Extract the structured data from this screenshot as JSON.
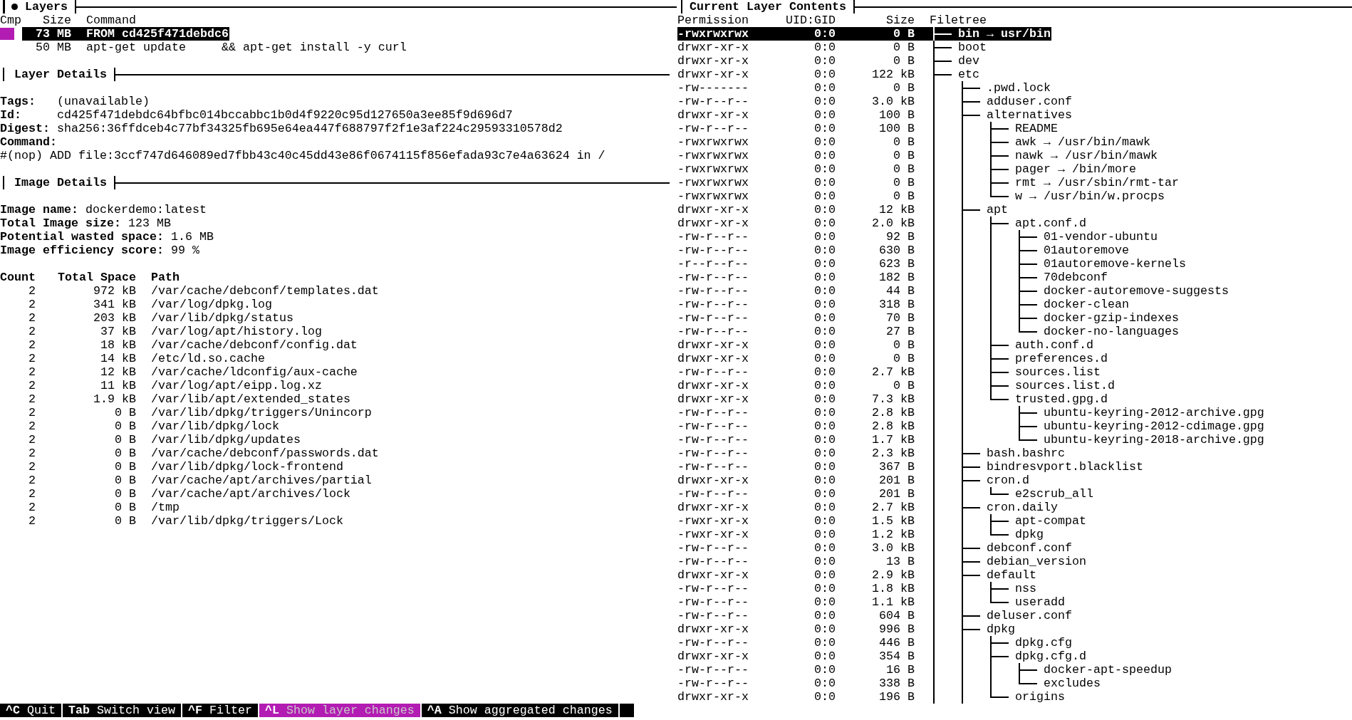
{
  "layers": {
    "title": "Layers",
    "focused": true,
    "columns": [
      "Cmp",
      "Size",
      "Command"
    ],
    "rows": [
      {
        "cmp": true,
        "size": "73 MB",
        "command": "FROM cd425f471debdc6",
        "selected": true
      },
      {
        "cmp": false,
        "size": "50 MB",
        "command": "apt-get update     && apt-get install -y curl",
        "selected": false
      }
    ]
  },
  "layer_details": {
    "title": "Layer Details",
    "fields": [
      {
        "kind": "inline",
        "label": "Tags:",
        "value": "(unavailable)"
      },
      {
        "kind": "inline",
        "label": "Id:",
        "value": "cd425f471debdc64bfbc014bccabbc1b0d4f9220c95d127650a3ee85f9d696d7"
      },
      {
        "kind": "inline",
        "label": "Digest:",
        "value": "sha256:36ffdceb4c77bf34325fb695e64ea447f688797f2f1e3af224c29593310578d2"
      },
      {
        "kind": "block",
        "label": "Command:",
        "value": "#(nop) ADD file:3ccf747d646089ed7fbb43c40c45dd43e86f0674115f856efada93c7e4a63624 in /"
      }
    ]
  },
  "image_details": {
    "title": "Image Details",
    "fields": [
      {
        "label": "Image name:",
        "value": "dockerdemo:latest"
      },
      {
        "label": "Total Image size:",
        "value": "123 MB"
      },
      {
        "label": "Potential wasted space:",
        "value": "1.6 MB"
      },
      {
        "label": "Image efficiency score:",
        "value": "99 %"
      }
    ],
    "columns": [
      "Count",
      "Total Space",
      "Path"
    ],
    "rows": [
      {
        "count": "2",
        "total_space": "972 kB",
        "path": "/var/cache/debconf/templates.dat"
      },
      {
        "count": "2",
        "total_space": "341 kB",
        "path": "/var/log/dpkg.log"
      },
      {
        "count": "2",
        "total_space": "203 kB",
        "path": "/var/lib/dpkg/status"
      },
      {
        "count": "2",
        "total_space": "37 kB",
        "path": "/var/log/apt/history.log"
      },
      {
        "count": "2",
        "total_space": "18 kB",
        "path": "/var/cache/debconf/config.dat"
      },
      {
        "count": "2",
        "total_space": "14 kB",
        "path": "/etc/ld.so.cache"
      },
      {
        "count": "2",
        "total_space": "12 kB",
        "path": "/var/cache/ldconfig/aux-cache"
      },
      {
        "count": "2",
        "total_space": "11 kB",
        "path": "/var/log/apt/eipp.log.xz"
      },
      {
        "count": "2",
        "total_space": "1.9 kB",
        "path": "/var/lib/apt/extended_states"
      },
      {
        "count": "2",
        "total_space": "0 B",
        "path": "/var/lib/dpkg/triggers/Unincorp"
      },
      {
        "count": "2",
        "total_space": "0 B",
        "path": "/var/lib/dpkg/lock"
      },
      {
        "count": "2",
        "total_space": "0 B",
        "path": "/var/lib/dpkg/updates"
      },
      {
        "count": "2",
        "total_space": "0 B",
        "path": "/var/cache/debconf/passwords.dat"
      },
      {
        "count": "2",
        "total_space": "0 B",
        "path": "/var/lib/dpkg/lock-frontend"
      },
      {
        "count": "2",
        "total_space": "0 B",
        "path": "/var/cache/apt/archives/partial"
      },
      {
        "count": "2",
        "total_space": "0 B",
        "path": "/var/cache/apt/archives/lock"
      },
      {
        "count": "2",
        "total_space": "0 B",
        "path": "/tmp"
      },
      {
        "count": "2",
        "total_space": "0 B",
        "path": "/var/lib/dpkg/triggers/Lock"
      }
    ]
  },
  "filetree": {
    "title": "Current Layer Contents",
    "columns": [
      "Permission",
      "UID:GID",
      "Size",
      "Filetree"
    ],
    "cut": true,
    "entries": [
      {
        "permission": "-rwxrwxrwx",
        "uid_gid": "0:0",
        "size": "0 B",
        "name": "bin → usr/bin",
        "selected": true
      },
      {
        "permission": "drwxr-xr-x",
        "uid_gid": "0:0",
        "size": "0 B",
        "name": "boot",
        "selected": false
      },
      {
        "permission": "drwxr-xr-x",
        "uid_gid": "0:0",
        "size": "0 B",
        "name": "dev",
        "selected": false
      },
      {
        "permission": "drwxr-xr-x",
        "uid_gid": "0:0",
        "size": "122 kB",
        "name": "etc",
        "selected": false,
        "cut": true,
        "children": [
          {
            "permission": "-rw-------",
            "uid_gid": "0:0",
            "size": "0 B",
            "name": ".pwd.lock",
            "selected": false
          },
          {
            "permission": "-rw-r--r--",
            "uid_gid": "0:0",
            "size": "3.0 kB",
            "name": "adduser.conf",
            "selected": false
          },
          {
            "permission": "drwxr-xr-x",
            "uid_gid": "0:0",
            "size": "100 B",
            "name": "alternatives",
            "selected": false,
            "children": [
              {
                "permission": "-rw-r--r--",
                "uid_gid": "0:0",
                "size": "100 B",
                "name": "README",
                "selected": false
              },
              {
                "permission": "-rwxrwxrwx",
                "uid_gid": "0:0",
                "size": "0 B",
                "name": "awk → /usr/bin/mawk",
                "selected": false
              },
              {
                "permission": "-rwxrwxrwx",
                "uid_gid": "0:0",
                "size": "0 B",
                "name": "nawk → /usr/bin/mawk",
                "selected": false
              },
              {
                "permission": "-rwxrwxrwx",
                "uid_gid": "0:0",
                "size": "0 B",
                "name": "pager → /bin/more",
                "selected": false
              },
              {
                "permission": "-rwxrwxrwx",
                "uid_gid": "0:0",
                "size": "0 B",
                "name": "rmt → /usr/sbin/rmt-tar",
                "selected": false
              },
              {
                "permission": "-rwxrwxrwx",
                "uid_gid": "0:0",
                "size": "0 B",
                "name": "w → /usr/bin/w.procps",
                "selected": false
              }
            ]
          },
          {
            "permission": "drwxr-xr-x",
            "uid_gid": "0:0",
            "size": "12 kB",
            "name": "apt",
            "selected": false,
            "children": [
              {
                "permission": "drwxr-xr-x",
                "uid_gid": "0:0",
                "size": "2.0 kB",
                "name": "apt.conf.d",
                "selected": false,
                "children": [
                  {
                    "permission": "-rw-r--r--",
                    "uid_gid": "0:0",
                    "size": "92 B",
                    "name": "01-vendor-ubuntu",
                    "selected": false
                  },
                  {
                    "permission": "-rw-r--r--",
                    "uid_gid": "0:0",
                    "size": "630 B",
                    "name": "01autoremove",
                    "selected": false
                  },
                  {
                    "permission": "-r--r--r--",
                    "uid_gid": "0:0",
                    "size": "623 B",
                    "name": "01autoremove-kernels",
                    "selected": false
                  },
                  {
                    "permission": "-rw-r--r--",
                    "uid_gid": "0:0",
                    "size": "182 B",
                    "name": "70debconf",
                    "selected": false
                  },
                  {
                    "permission": "-rw-r--r--",
                    "uid_gid": "0:0",
                    "size": "44 B",
                    "name": "docker-autoremove-suggests",
                    "selected": false
                  },
                  {
                    "permission": "-rw-r--r--",
                    "uid_gid": "0:0",
                    "size": "318 B",
                    "name": "docker-clean",
                    "selected": false
                  },
                  {
                    "permission": "-rw-r--r--",
                    "uid_gid": "0:0",
                    "size": "70 B",
                    "name": "docker-gzip-indexes",
                    "selected": false
                  },
                  {
                    "permission": "-rw-r--r--",
                    "uid_gid": "0:0",
                    "size": "27 B",
                    "name": "docker-no-languages",
                    "selected": false
                  }
                ]
              },
              {
                "permission": "drwxr-xr-x",
                "uid_gid": "0:0",
                "size": "0 B",
                "name": "auth.conf.d",
                "selected": false
              },
              {
                "permission": "drwxr-xr-x",
                "uid_gid": "0:0",
                "size": "0 B",
                "name": "preferences.d",
                "selected": false
              },
              {
                "permission": "-rw-r--r--",
                "uid_gid": "0:0",
                "size": "2.7 kB",
                "name": "sources.list",
                "selected": false
              },
              {
                "permission": "drwxr-xr-x",
                "uid_gid": "0:0",
                "size": "0 B",
                "name": "sources.list.d",
                "selected": false
              },
              {
                "permission": "drwxr-xr-x",
                "uid_gid": "0:0",
                "size": "7.3 kB",
                "name": "trusted.gpg.d",
                "selected": false,
                "children": [
                  {
                    "permission": "-rw-r--r--",
                    "uid_gid": "0:0",
                    "size": "2.8 kB",
                    "name": "ubuntu-keyring-2012-archive.gpg",
                    "selected": false
                  },
                  {
                    "permission": "-rw-r--r--",
                    "uid_gid": "0:0",
                    "size": "2.8 kB",
                    "name": "ubuntu-keyring-2012-cdimage.gpg",
                    "selected": false
                  },
                  {
                    "permission": "-rw-r--r--",
                    "uid_gid": "0:0",
                    "size": "1.7 kB",
                    "name": "ubuntu-keyring-2018-archive.gpg",
                    "selected": false
                  }
                ]
              }
            ]
          },
          {
            "permission": "-rw-r--r--",
            "uid_gid": "0:0",
            "size": "2.3 kB",
            "name": "bash.bashrc",
            "selected": false
          },
          {
            "permission": "-rw-r--r--",
            "uid_gid": "0:0",
            "size": "367 B",
            "name": "bindresvport.blacklist",
            "selected": false
          },
          {
            "permission": "drwxr-xr-x",
            "uid_gid": "0:0",
            "size": "201 B",
            "name": "cron.d",
            "selected": false,
            "children": [
              {
                "permission": "-rw-r--r--",
                "uid_gid": "0:0",
                "size": "201 B",
                "name": "e2scrub_all",
                "selected": false
              }
            ]
          },
          {
            "permission": "drwxr-xr-x",
            "uid_gid": "0:0",
            "size": "2.7 kB",
            "name": "cron.daily",
            "selected": false,
            "children": [
              {
                "permission": "-rwxr-xr-x",
                "uid_gid": "0:0",
                "size": "1.5 kB",
                "name": "apt-compat",
                "selected": false
              },
              {
                "permission": "-rwxr-xr-x",
                "uid_gid": "0:0",
                "size": "1.2 kB",
                "name": "dpkg",
                "selected": false
              }
            ]
          },
          {
            "permission": "-rw-r--r--",
            "uid_gid": "0:0",
            "size": "3.0 kB",
            "name": "debconf.conf",
            "selected": false
          },
          {
            "permission": "-rw-r--r--",
            "uid_gid": "0:0",
            "size": "13 B",
            "name": "debian_version",
            "selected": false
          },
          {
            "permission": "drwxr-xr-x",
            "uid_gid": "0:0",
            "size": "2.9 kB",
            "name": "default",
            "selected": false,
            "children": [
              {
                "permission": "-rw-r--r--",
                "uid_gid": "0:0",
                "size": "1.8 kB",
                "name": "nss",
                "selected": false
              },
              {
                "permission": "-rw-r--r--",
                "uid_gid": "0:0",
                "size": "1.1 kB",
                "name": "useradd",
                "selected": false
              }
            ]
          },
          {
            "permission": "-rw-r--r--",
            "uid_gid": "0:0",
            "size": "604 B",
            "name": "deluser.conf",
            "selected": false
          },
          {
            "permission": "drwxr-xr-x",
            "uid_gid": "0:0",
            "size": "996 B",
            "name": "dpkg",
            "selected": false,
            "children": [
              {
                "permission": "-rw-r--r--",
                "uid_gid": "0:0",
                "size": "446 B",
                "name": "dpkg.cfg",
                "selected": false
              },
              {
                "permission": "drwxr-xr-x",
                "uid_gid": "0:0",
                "size": "354 B",
                "name": "dpkg.cfg.d",
                "selected": false,
                "children": [
                  {
                    "permission": "-rw-r--r--",
                    "uid_gid": "0:0",
                    "size": "16 B",
                    "name": "docker-apt-speedup",
                    "selected": false
                  },
                  {
                    "permission": "-rw-r--r--",
                    "uid_gid": "0:0",
                    "size": "338 B",
                    "name": "excludes",
                    "selected": false
                  }
                ]
              },
              {
                "permission": "drwxr-xr-x",
                "uid_gid": "0:0",
                "size": "196 B",
                "name": "origins",
                "selected": false
              }
            ]
          }
        ]
      }
    ]
  },
  "keybar": [
    {
      "key": "^C",
      "label": "Quit",
      "selected": false
    },
    {
      "key": "Tab",
      "label": "Switch view",
      "selected": false
    },
    {
      "key": "^F",
      "label": "Filter",
      "selected": false
    },
    {
      "key": "^L",
      "label": "Show layer changes",
      "selected": true
    },
    {
      "key": "^A",
      "label": "Show aggregated changes",
      "selected": false
    }
  ]
}
